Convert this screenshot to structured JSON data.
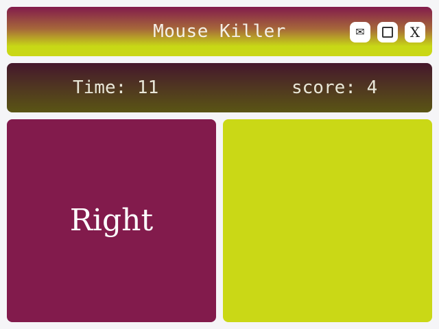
{
  "window": {
    "title": "Mouse Killer",
    "buttons": {
      "mail_icon": "envelope-icon",
      "maximize_icon": "square-icon",
      "close_label": "X"
    },
    "colors": {
      "primary": "#821b4c",
      "accent": "#cad816"
    }
  },
  "status": {
    "time_label": "Time: 11",
    "score_label": "score: 4"
  },
  "game": {
    "left_panel_text": "Right",
    "right_panel_text": ""
  }
}
